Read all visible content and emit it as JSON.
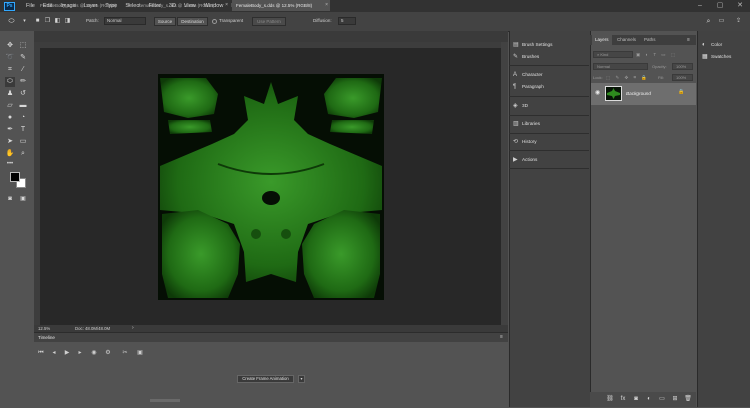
{
  "app": {
    "logo": "Ps"
  },
  "menu": [
    "File",
    "Edit",
    "Image",
    "Layer",
    "Type",
    "Select",
    "Filter",
    "3D",
    "View",
    "Window",
    "Help"
  ],
  "options_bar": {
    "patch_label": "Patch:",
    "patch_value": "Normal",
    "source_label": "Source",
    "destination_label": "Destination",
    "transparent_label": "Transparent",
    "use_pattern_label": "Use Pattern",
    "diffusion_label": "Diffusion:",
    "diffusion_value": "5"
  },
  "tabs": [
    {
      "title": "FemaleBody_s.dds @ 12.5% (RGB/8)",
      "active": false
    },
    {
      "title": "FemaleBody_s.dds @ 12.5% (RGB/8)",
      "active": false
    },
    {
      "title": "FemaleBody_s.dds @ 12.5% (RGB/8)",
      "active": true
    }
  ],
  "status": {
    "zoom": "12.5%",
    "doc": "Doc: 48.0M/48.0M"
  },
  "timeline": {
    "title": "Timeline",
    "create_button": "Create Frame Animation"
  },
  "mid_panels": [
    "Brush Settings",
    "Brushes",
    "Character",
    "Paragraph",
    "3D",
    "Libraries",
    "History",
    "Actions"
  ],
  "layers_panel": {
    "tabs": [
      "Layers",
      "Channels",
      "Paths"
    ],
    "kind_placeholder": "Kind",
    "blend_mode": "Normal",
    "opacity_label": "Opacity:",
    "opacity_value": "100%",
    "lock_label": "Lock:",
    "fill_label": "Fill:",
    "fill_value": "100%",
    "layers": [
      {
        "name": "Background",
        "visible": true,
        "locked": true
      }
    ]
  },
  "right_panels": [
    "Color",
    "Swatches"
  ],
  "colors": {
    "accent": "#31a8ff",
    "texture": "#2e8a1e"
  }
}
